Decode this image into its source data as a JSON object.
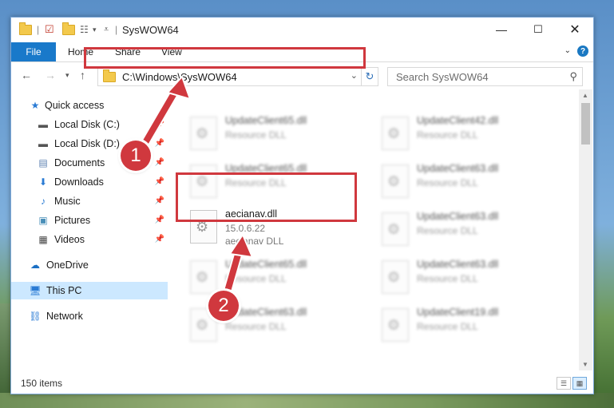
{
  "window": {
    "title": "SysWOW64"
  },
  "ribbon": {
    "tabs": [
      "File",
      "Home",
      "Share",
      "View"
    ],
    "help": "?"
  },
  "address": {
    "path": "C:\\Windows\\SysWOW64"
  },
  "search": {
    "placeholder": "Search SysWOW64"
  },
  "sidebar": {
    "items": [
      {
        "label": "Quick access",
        "icon": "star-icon",
        "pinned": false
      },
      {
        "label": "Local Disk (C:)",
        "icon": "drive-icon",
        "pinned": true
      },
      {
        "label": "Local Disk (D:)",
        "icon": "drive-icon",
        "pinned": true
      },
      {
        "label": "Documents",
        "icon": "documents-icon",
        "pinned": true
      },
      {
        "label": "Downloads",
        "icon": "download-icon",
        "pinned": true
      },
      {
        "label": "Music",
        "icon": "music-icon",
        "pinned": true
      },
      {
        "label": "Pictures",
        "icon": "pictures-icon",
        "pinned": true
      },
      {
        "label": "Videos",
        "icon": "videos-icon",
        "pinned": true
      },
      {
        "label": "OneDrive",
        "icon": "cloud-icon"
      },
      {
        "label": "This PC",
        "icon": "computer-icon",
        "selected": true
      },
      {
        "label": "Network",
        "icon": "network-icon"
      }
    ]
  },
  "files": [
    {
      "name": "UpdateClient65.dll",
      "type": "Resource DLL"
    },
    {
      "name": "UpdateClient42.dll",
      "type": "Resource DLL"
    },
    {
      "name": "UpdateClient65.dll",
      "type": "Resource DLL"
    },
    {
      "name": "UpdateClient63.dll",
      "type": "Resource DLL"
    },
    {
      "name": "aecianav.dll",
      "version": "15.0.6.22",
      "type": "aecianav DLL"
    },
    {
      "name": "UpdateClient63.dll",
      "type": "Resource DLL"
    },
    {
      "name": "UpdateClient65.dll",
      "type": "Resource DLL"
    },
    {
      "name": "UpdateClient63.dll",
      "type": "Resource DLL"
    },
    {
      "name": "UpdateClient63.dll",
      "type": "Resource DLL"
    },
    {
      "name": "UpdateClient19.dll",
      "type": "Resource DLL"
    }
  ],
  "status": {
    "count": "150 items"
  },
  "callouts": [
    "1",
    "2"
  ],
  "colors": {
    "accent": "#1979ca",
    "highlight": "#d0383e",
    "selected": "#cce8ff"
  }
}
